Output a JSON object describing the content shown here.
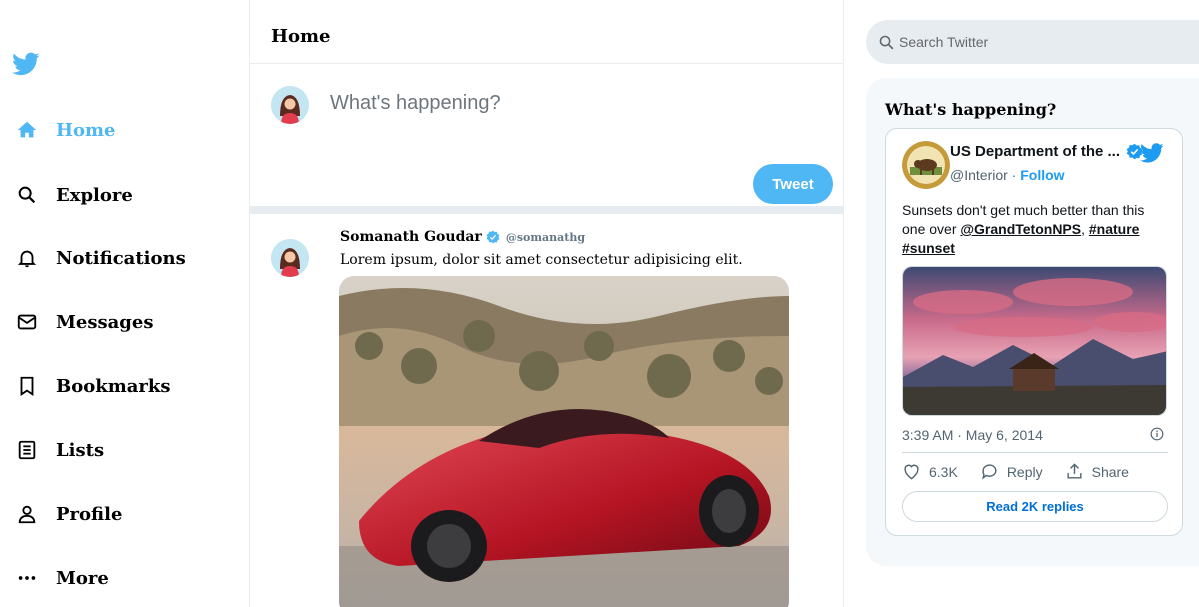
{
  "sidebar": {
    "items": [
      {
        "label": "Home",
        "icon": "home-icon"
      },
      {
        "label": "Explore",
        "icon": "search-icon"
      },
      {
        "label": "Notifications",
        "icon": "bell-icon"
      },
      {
        "label": "Messages",
        "icon": "mail-icon"
      },
      {
        "label": "Bookmarks",
        "icon": "bookmark-icon"
      },
      {
        "label": "Lists",
        "icon": "list-icon"
      },
      {
        "label": "Profile",
        "icon": "person-icon"
      },
      {
        "label": "More",
        "icon": "more-icon"
      }
    ]
  },
  "feed": {
    "title": "Home",
    "composer": {
      "placeholder": "What's happening?",
      "button_label": "Tweet"
    },
    "post": {
      "name": "Somanath Goudar",
      "handle": "@somanathg",
      "text": "Lorem ipsum, dolor sit amet consectetur adipisicing elit."
    }
  },
  "widgets": {
    "search_placeholder": "Search Twitter",
    "title": "What's happening?",
    "embed": {
      "author": "US Department of the ...",
      "handle": "@Interior",
      "separator": "·",
      "follow": "Follow",
      "text_plain": "Sunsets don't get much better than this one over",
      "mention": "@GrandTetonNPS",
      "comma": ",",
      "hashtag_1": "#nature",
      "hashtag_2": "#sunset",
      "time": "3:39 AM · May 6, 2014",
      "likes": "6.3K",
      "reply_label": "Reply",
      "share_label": "Share",
      "read_replies": "Read 2K replies"
    }
  },
  "colors": {
    "accent": "#50b7f5",
    "twitter_blue": "#1d9bf0",
    "border": "#e6ecf0",
    "widget_bg": "#f5f8fa"
  }
}
